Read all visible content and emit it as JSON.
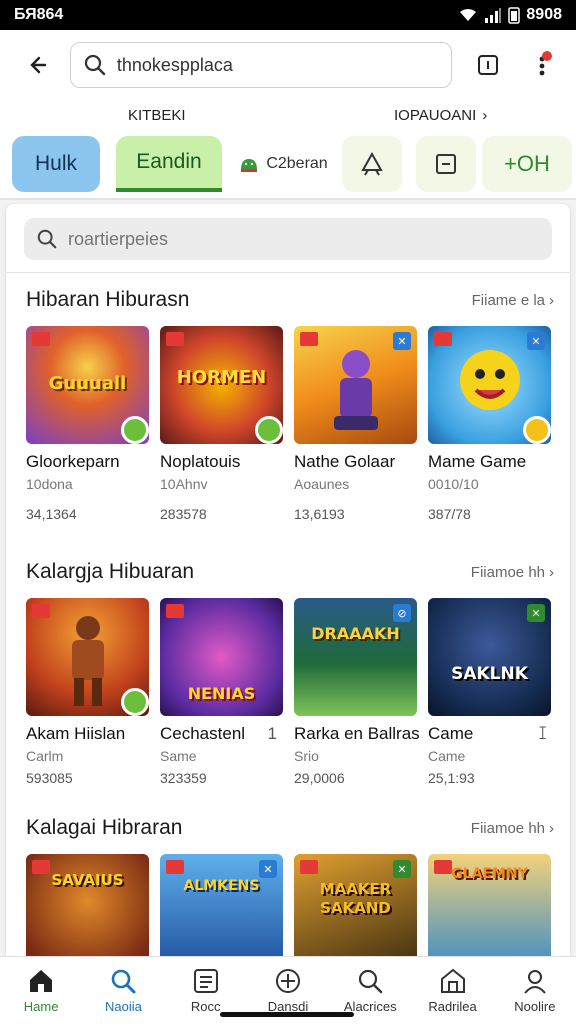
{
  "status": {
    "time": "БЯ864",
    "right_text": "8908"
  },
  "top_bar": {
    "search_value": "thnokespplaca"
  },
  "sub_header": {
    "left": "KITBEKI",
    "right": "IOPAUOANI",
    "right_chevron": "›"
  },
  "chips": [
    {
      "label": "Hulk"
    },
    {
      "label": "Eandin"
    },
    {
      "label": "C2beran"
    },
    {
      "label": ""
    },
    {
      "label": ""
    },
    {
      "label": "+OH"
    }
  ],
  "panel": {
    "search_placeholder": "roartierpeies"
  },
  "sections": [
    {
      "title": "Hibaran Hiburasn",
      "more": "Fiiame e la",
      "more_icon": "›",
      "cards": [
        {
          "name": "Gloorkeparn",
          "sub": "10dona",
          "stat": "34,1364",
          "art_text": "Guuuall",
          "colors": [
            "#7b3fc4",
            "#f2a21a"
          ]
        },
        {
          "name": "Noplatouis",
          "sub": "10Ahnv",
          "stat": "283578",
          "art_text": "HORMEN",
          "colors": [
            "#b02a2a",
            "#f4b400"
          ]
        },
        {
          "name": "Nathe Golaar",
          "sub": "Aoaunes",
          "stat": "13,6193",
          "art_text": "",
          "colors": [
            "#f08c1a",
            "#f7d34c"
          ]
        },
        {
          "name": "Mame Game",
          "sub": "0010/10",
          "stat": "387/78",
          "art_text": "",
          "colors": [
            "#3aa0e0",
            "#7fd0f5"
          ]
        }
      ]
    },
    {
      "title": "Kalargja Hibuaran",
      "more": "Fiiamoe hh",
      "more_icon": "›",
      "cards": [
        {
          "name": "Akam Hiislan",
          "sub": "Carlm",
          "stat": "593085",
          "art_text": "",
          "colors": [
            "#c2411c",
            "#f3a133"
          ]
        },
        {
          "name": "Cechastenl",
          "sub": "Same",
          "stat": "323359",
          "art_text": "NENIAS",
          "colors": [
            "#5a2ba0",
            "#e25ac8"
          ],
          "extra": "1"
        },
        {
          "name": "Rarka en Ballras",
          "sub": "Srio",
          "stat": "29,0006",
          "art_text": "DRAAAKH",
          "colors": [
            "#1f6a3a",
            "#7fc35a"
          ]
        },
        {
          "name": "Came",
          "sub": "Came",
          "stat": "25,1:93",
          "art_text": "SAKLNK",
          "colors": [
            "#142a4f",
            "#3c5a9a"
          ],
          "extra": "ꕯ"
        }
      ]
    },
    {
      "title": "Kalagai Hibraran",
      "more": "Fiiamoe hh",
      "more_icon": "›",
      "cards": [
        {
          "name": "",
          "sub": "",
          "stat": "",
          "art_text": "SAVAIUS",
          "colors": [
            "#7a2a14",
            "#e08a2a"
          ]
        },
        {
          "name": "",
          "sub": "",
          "stat": "",
          "art_text": "ALMKENS",
          "colors": [
            "#1d4e9e",
            "#5fb0ea"
          ]
        },
        {
          "name": "",
          "sub": "",
          "stat": "",
          "art_text": "MAAKER SAKAND",
          "colors": [
            "#3b2a10",
            "#e0a030"
          ]
        },
        {
          "name": "",
          "sub": "",
          "stat": "",
          "art_text": "GLAEMNY",
          "colors": [
            "#3a8ac8",
            "#f2d27a"
          ]
        }
      ]
    }
  ],
  "bottom_nav": [
    {
      "label": "Hame",
      "icon": "home-icon"
    },
    {
      "label": "Naoiia",
      "icon": "search-icon"
    },
    {
      "label": "Rocc",
      "icon": "list-icon"
    },
    {
      "label": "Dansdi",
      "icon": "compass-icon"
    },
    {
      "label": "Alacrices",
      "icon": "search-icon"
    },
    {
      "label": "Radrilea",
      "icon": "store-icon"
    },
    {
      "label": "Noolire",
      "icon": "profile-icon"
    }
  ],
  "colors": {
    "accent_green": "#2e8b2e",
    "accent_blue": "#1e73b8",
    "chip_blue": "#8cc5ee",
    "chip_green": "#c9f0a8"
  }
}
